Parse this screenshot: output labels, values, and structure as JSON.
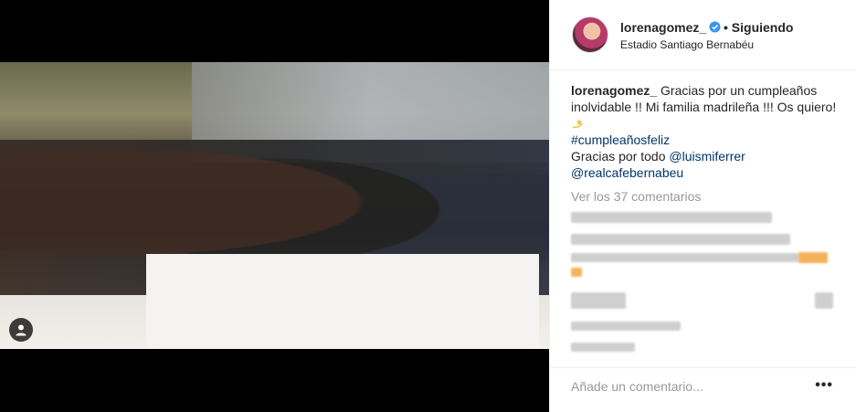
{
  "post": {
    "username": "lorenagomez_",
    "follow_status": "• Siguiendo",
    "location": "Estadio Santiago Bernabéu",
    "caption_username": "lorenagomez_",
    "caption_text": " Gracias por un cumpleaños inolvidable !! Mi familia madrileña !!! Os quiero! ",
    "hashtag": "#cumpleañosfeliz",
    "thanks_text": "Gracias por todo ",
    "mention_1": "@luismiferrer",
    "mention_2": "@realcafebernabeu",
    "view_comments": "Ver los 37 comentarios"
  },
  "footer": {
    "comment_placeholder": "Añade un comentario...",
    "more_label": "•••"
  },
  "icons": {
    "verified": "verified-badge-icon",
    "emoji": "dizzy-star-emoji-icon",
    "user_tag": "user-tag-icon"
  },
  "colors": {
    "link": "#003569",
    "verified": "#3897f0",
    "muted": "#999999"
  }
}
